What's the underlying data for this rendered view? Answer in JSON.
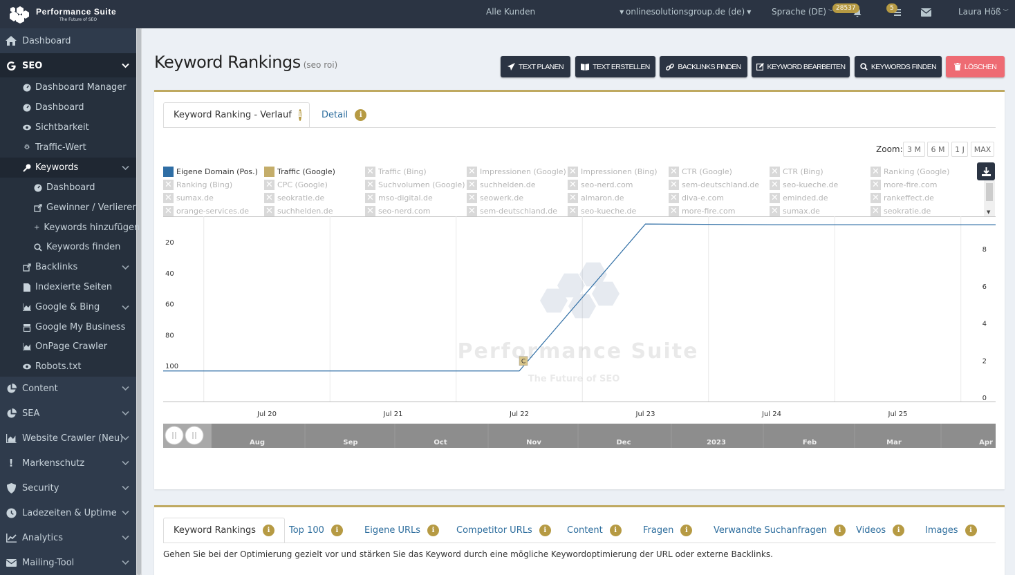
{
  "brand": {
    "name": "Performance Suite",
    "tagline": "The Future of SEO"
  },
  "topbar": {
    "customer": "Alle Kunden",
    "domain": "onlinesolutionsgroup.de (de)",
    "language": "Sprache (DE)",
    "notifications_count": "28537",
    "tasks_count": "5",
    "user": "Laura Höß"
  },
  "sidebar": {
    "items": [
      {
        "label": "Dashboard",
        "icon": "home-icon"
      },
      {
        "label": "SEO",
        "icon": "google-g-icon"
      },
      {
        "label": "Dashboard Manager",
        "icon": "dashboard-icon"
      },
      {
        "label": "Dashboard",
        "icon": "dashboard-icon"
      },
      {
        "label": "Sichtbarkeit",
        "icon": "eye-icon"
      },
      {
        "label": "Traffic-Wert",
        "icon": "cogs-icon"
      },
      {
        "label": "Keywords",
        "icon": "key-icon"
      },
      {
        "label": "Dashboard",
        "icon": "dashboard-icon"
      },
      {
        "label": "Gewinner / Verlierer",
        "icon": "external-link-icon"
      },
      {
        "label": "Keywords hinzufügen",
        "icon": "plus-icon"
      },
      {
        "label": "Keywords finden",
        "icon": "search-icon"
      },
      {
        "label": "Backlinks",
        "icon": "external-link-icon"
      },
      {
        "label": "Indexierte Seiten",
        "icon": "file-icon"
      },
      {
        "label": "Google & Bing",
        "icon": "area-chart-icon"
      },
      {
        "label": "Google My Business",
        "icon": "store-icon"
      },
      {
        "label": "OnPage Crawler",
        "icon": "area-chart-icon"
      },
      {
        "label": "Robots.txt",
        "icon": "eye-icon"
      },
      {
        "label": "Content",
        "icon": "pie-chart-icon"
      },
      {
        "label": "SEA",
        "icon": "pie-chart-icon"
      },
      {
        "label": "Website Crawler (Neu)",
        "icon": "area-chart-icon"
      },
      {
        "label": "Markenschutz",
        "icon": "exclamation-icon"
      },
      {
        "label": "Security",
        "icon": "shield-icon"
      },
      {
        "label": "Ladezeiten & Uptime",
        "icon": "clock-icon"
      },
      {
        "label": "Analytics",
        "icon": "line-chart-icon"
      },
      {
        "label": "Mailing-Tool",
        "icon": "envelope-icon"
      }
    ]
  },
  "page": {
    "title": "Keyword Rankings",
    "subtitle": "(seo roi)"
  },
  "actions": [
    {
      "label": "TEXT PLANEN",
      "icon": "paper-plane-icon"
    },
    {
      "label": "TEXT ERSTELLEN",
      "icon": "book-icon"
    },
    {
      "label": "BACKLINKS FINDEN",
      "icon": "link-icon"
    },
    {
      "label": "KEYWORD BEARBEITEN",
      "icon": "edit-icon"
    },
    {
      "label": "KEYWORDS FINDEN",
      "icon": "search-icon"
    },
    {
      "label": "LÖSCHEN",
      "icon": "trash-icon"
    }
  ],
  "chart_tabs": [
    "Keyword Ranking - Verlauf",
    "Detail"
  ],
  "zoom": {
    "label": "Zoom:",
    "options": [
      "3 M",
      "6 M",
      "1 J",
      "MAX"
    ]
  },
  "legend": [
    {
      "label": "Eigene Domain (Pos.)",
      "active": true,
      "color": "#2f6ea5"
    },
    {
      "label": "Traffic (Google)",
      "active": true,
      "color": "#c4ad6a"
    },
    {
      "label": "Traffic (Bing)",
      "active": false
    },
    {
      "label": "Impressionen (Google)",
      "active": false
    },
    {
      "label": "Impressionen (Bing)",
      "active": false
    },
    {
      "label": "CTR (Google)",
      "active": false
    },
    {
      "label": "CTR (Bing)",
      "active": false
    },
    {
      "label": "Ranking (Google)",
      "active": false
    },
    {
      "label": "Ranking (Bing)",
      "active": false
    },
    {
      "label": "CPC (Google)",
      "active": false
    },
    {
      "label": "Suchvolumen (Google)",
      "active": false
    },
    {
      "label": "suchhelden.de",
      "active": false
    },
    {
      "label": "seo-nerd.com",
      "active": false
    },
    {
      "label": "sem-deutschland.de",
      "active": false
    },
    {
      "label": "seo-kueche.de",
      "active": false
    },
    {
      "label": "more-fire.com",
      "active": false
    },
    {
      "label": "sumax.de",
      "active": false
    },
    {
      "label": "seokratie.de",
      "active": false
    },
    {
      "label": "mso-digital.de",
      "active": false
    },
    {
      "label": "seowerk.de",
      "active": false
    },
    {
      "label": "almaron.de",
      "active": false
    },
    {
      "label": "diva-e.com",
      "active": false
    },
    {
      "label": "eminded.de",
      "active": false
    },
    {
      "label": "rankeffect.de",
      "active": false
    },
    {
      "label": "orange-services.de",
      "active": false
    },
    {
      "label": "suchhelden.de",
      "active": false
    },
    {
      "label": "seo-nerd.com",
      "active": false
    },
    {
      "label": "sem-deutschland.de",
      "active": false
    },
    {
      "label": "seo-kueche.de",
      "active": false
    },
    {
      "label": "more-fire.com",
      "active": false
    },
    {
      "label": "sumax.de",
      "active": false
    },
    {
      "label": "seokratie.de",
      "active": false
    }
  ],
  "chart_data": {
    "type": "line",
    "x_labels": [
      "Jul 20",
      "Jul 21",
      "Jul 22",
      "Jul 23",
      "Jul 24",
      "Jul 25"
    ],
    "y_left_ticks": [
      20,
      40,
      60,
      80,
      100
    ],
    "y_left_reversed": true,
    "y_right_ticks": [
      0,
      2,
      4,
      6,
      8
    ],
    "series": [
      {
        "name": "Eigene Domain (Pos.)",
        "axis": "left",
        "color": "#2f6ea5",
        "x": [
          "Jul 19",
          "Jul 22",
          "Jul 23",
          "Jul 24",
          "Jul 25",
          "Jul 26"
        ],
        "values": [
          103,
          103,
          8,
          8.5,
          8.5,
          8.5
        ]
      }
    ],
    "annotation": {
      "x": "Jul 22",
      "label": "C"
    },
    "watermark": {
      "title": "Performance Suite",
      "tagline": "The Future of SEO"
    },
    "grid": true
  },
  "navigator": {
    "labels": [
      "Aug",
      "Sep",
      "Oct",
      "Nov",
      "Dec",
      "2023",
      "Feb",
      "Mar",
      "Apr"
    ]
  },
  "bottom_tabs": [
    "Keyword Rankings",
    "Top 100",
    "Eigene URLs",
    "Competitor URLs",
    "Content",
    "Fragen",
    "Verwandte Suchanfragen",
    "Videos",
    "Images"
  ],
  "bottom_description": "Gehen Sie bei der Optimierung gezielt vor und stärken Sie das Keyword durch eine mögliche Keywordoptimierung der URL oder externe Backlinks."
}
